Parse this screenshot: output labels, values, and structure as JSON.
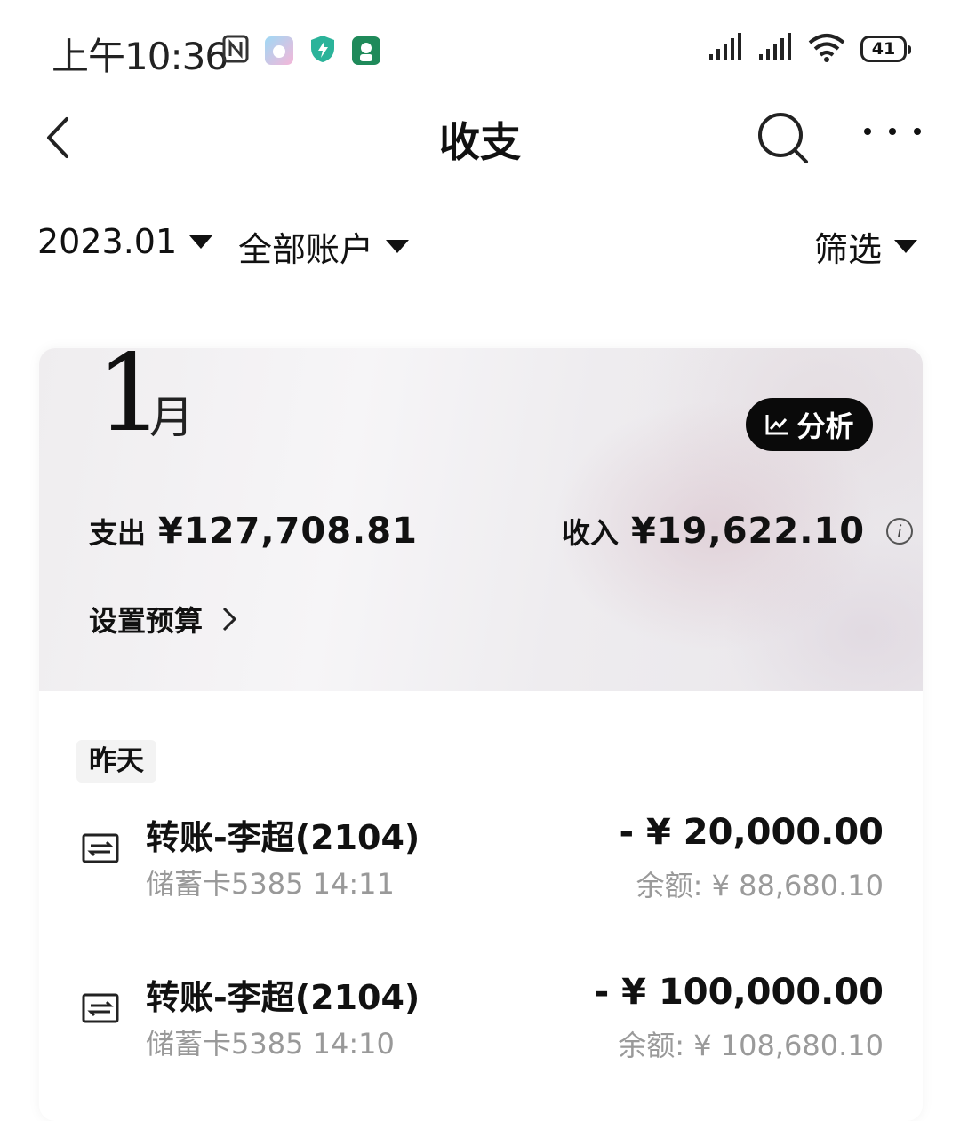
{
  "status_bar": {
    "time": "上午10:36",
    "battery": "41"
  },
  "header": {
    "title": "收支"
  },
  "filters": {
    "month": "2023.01",
    "account": "全部账户",
    "filter": "筛选"
  },
  "summary": {
    "month_number": "1",
    "month_unit": "月",
    "analysis_label": "分析",
    "expense_label": "支出",
    "expense_value": "¥127,708.81",
    "income_label": "收入",
    "income_value": "¥19,622.10",
    "budget_label": "设置预算"
  },
  "day_groups": [
    {
      "label": "昨天",
      "transactions": [
        {
          "title": "转账-李超(2104)",
          "subtitle": "储蓄卡5385 14:11",
          "amount": "- ¥ 20,000.00",
          "balance": "余额: ¥ 88,680.10"
        },
        {
          "title": "转账-李超(2104)",
          "subtitle": "储蓄卡5385 14:10",
          "amount": "- ¥ 100,000.00",
          "balance": "余额: ¥ 108,680.10"
        }
      ]
    }
  ],
  "icons": {
    "back": "chevron-left-icon",
    "search": "search-icon",
    "more": "more-icon",
    "transfer": "transfer-icon",
    "analysis": "trend-chart-icon",
    "info": "info-icon"
  },
  "colors": {
    "text_primary": "#111111",
    "text_secondary": "#999999",
    "analysis_button_bg": "#0a0a0a"
  }
}
